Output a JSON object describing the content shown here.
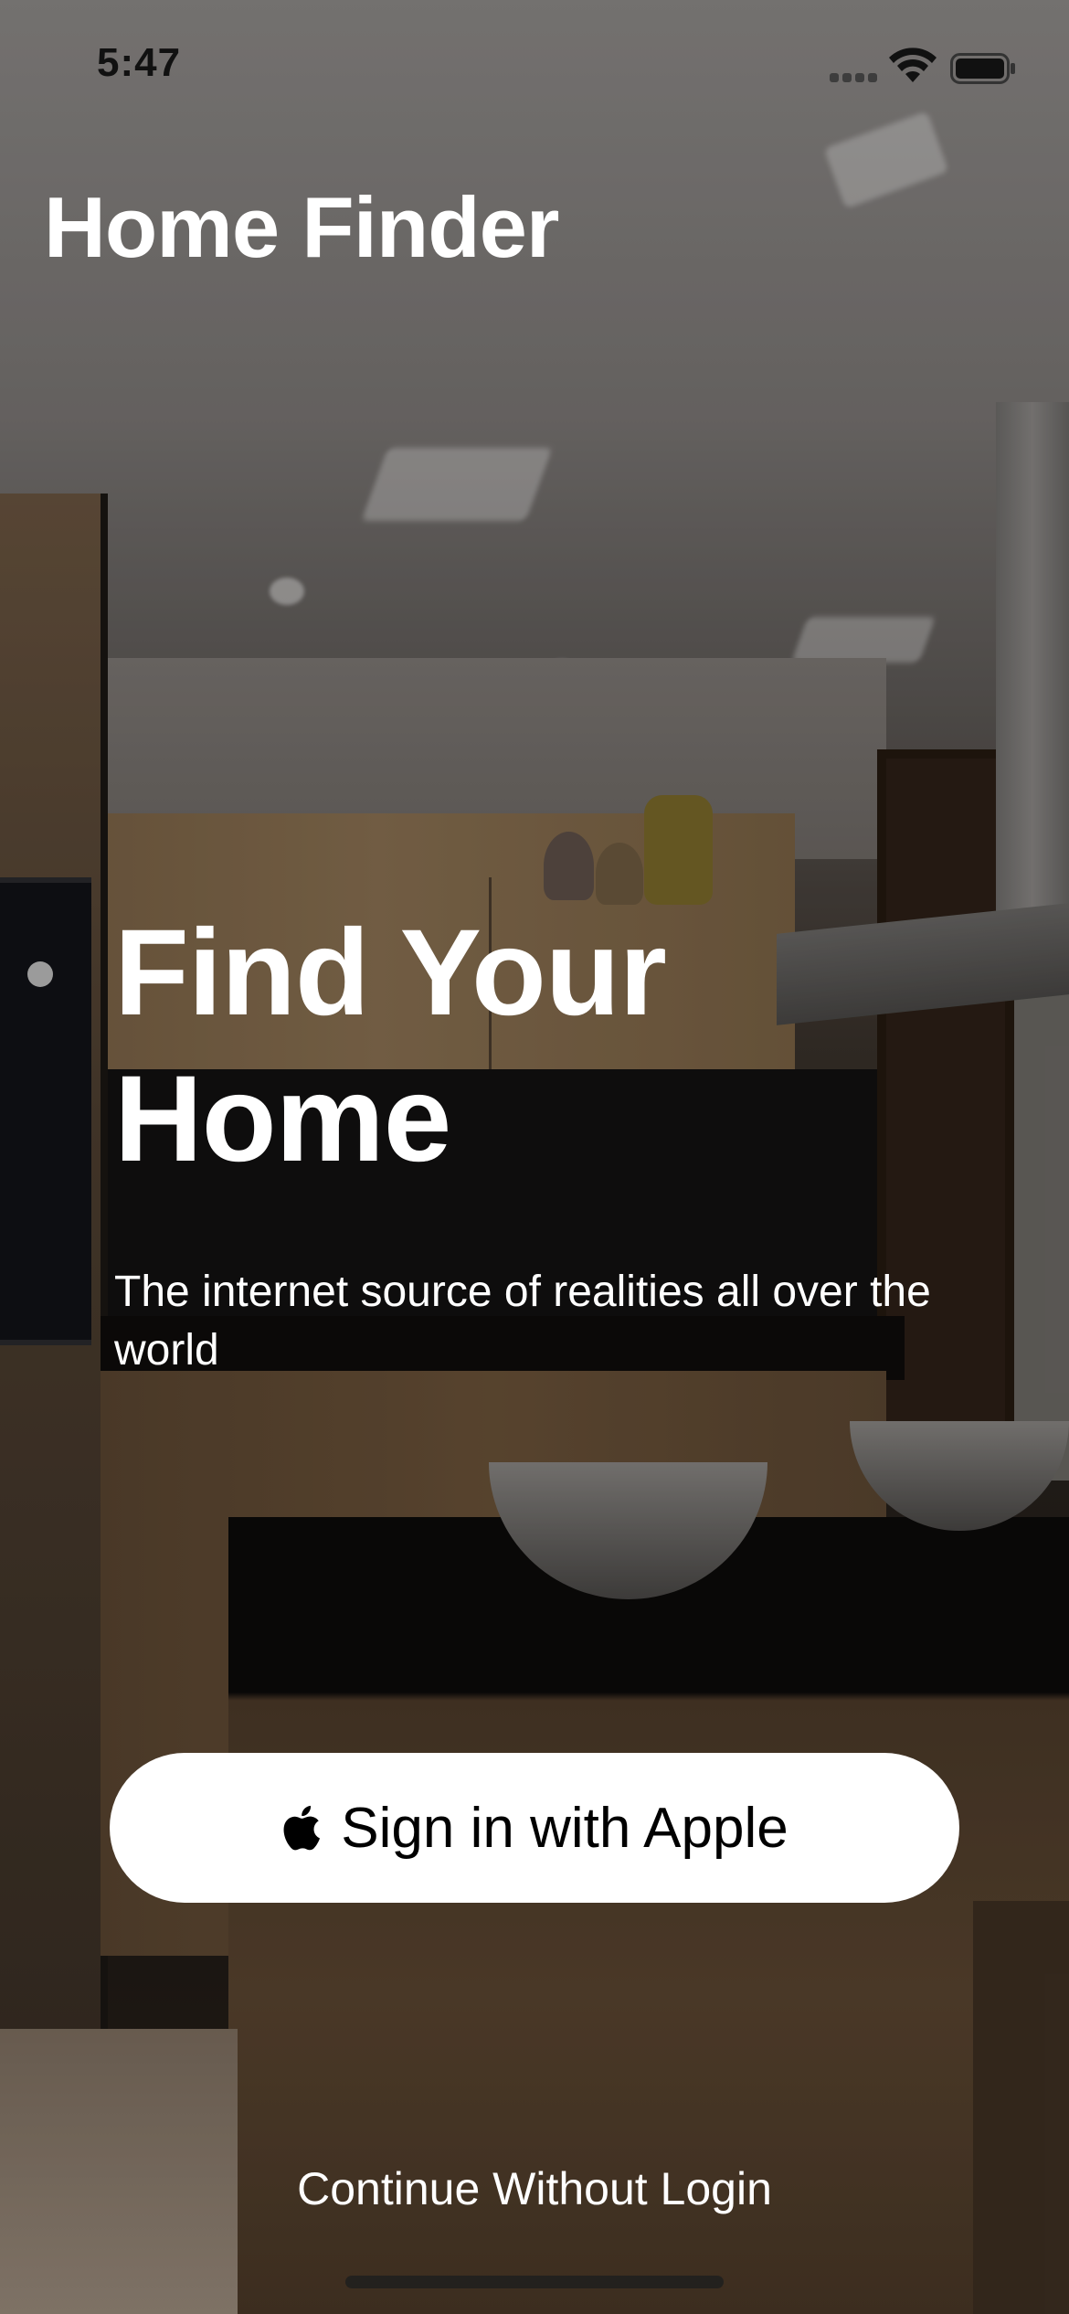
{
  "status_bar": {
    "time": "5:47"
  },
  "app": {
    "title": "Home Finder"
  },
  "hero": {
    "title": "Find Your Home",
    "subtitle": "The internet source of realities all over the world"
  },
  "actions": {
    "sign_in_label": "Sign in with Apple",
    "continue_label": "Continue Without Login"
  },
  "icons": {
    "apple": "apple-logo",
    "wifi": "wifi-icon",
    "battery": "battery-icon",
    "signal": "cellular-signal-icon"
  },
  "colors": {
    "button_background": "#ffffff",
    "button_text": "#000000",
    "text_primary": "#ffffff"
  }
}
